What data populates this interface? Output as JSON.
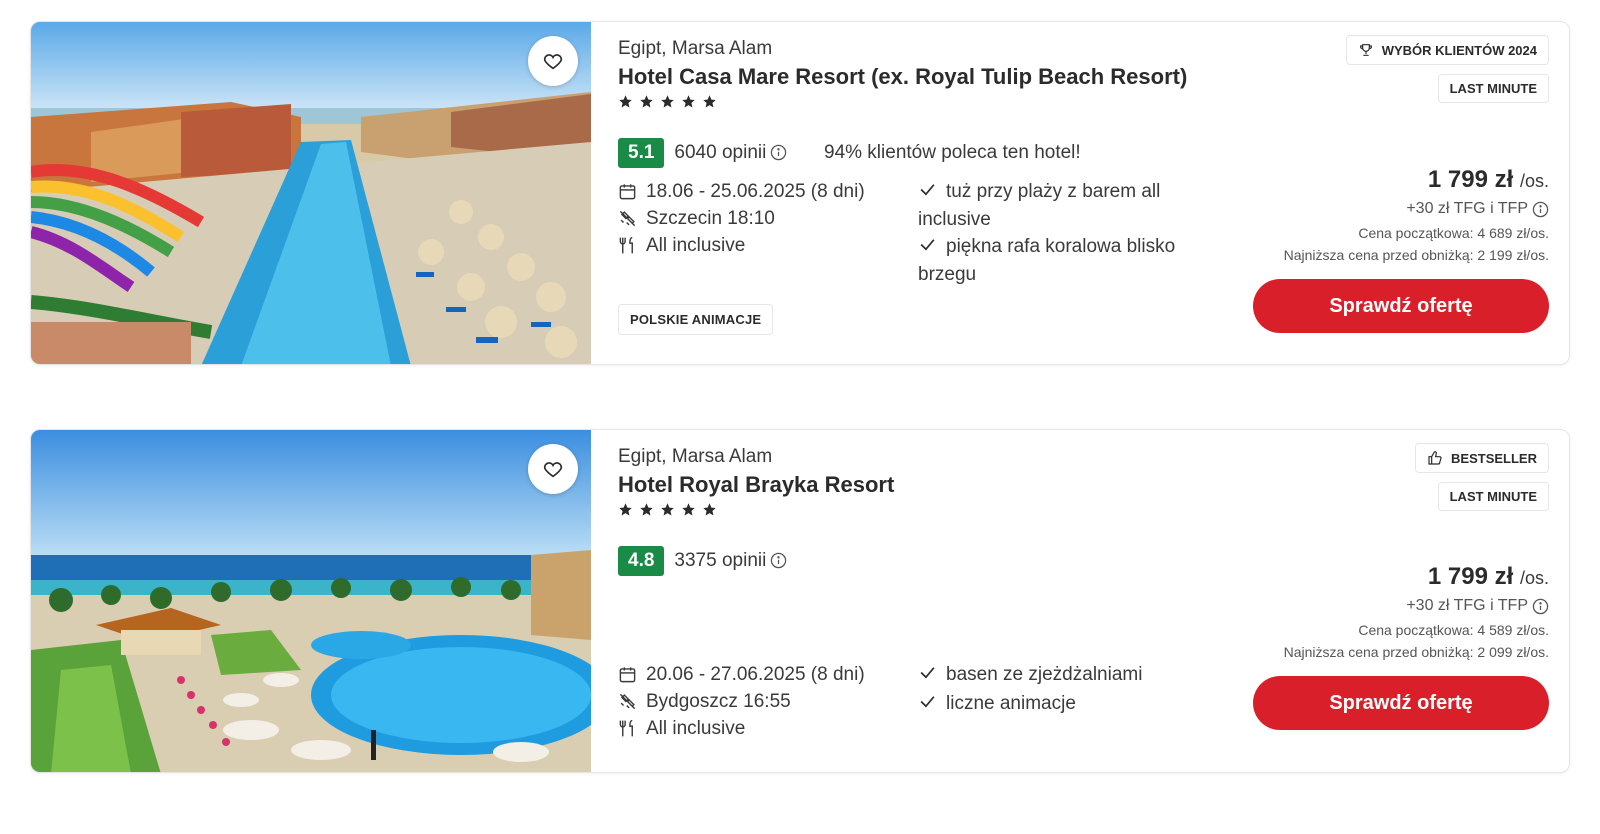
{
  "offers": [
    {
      "location": "Egipt, Marsa Alam",
      "name": "Hotel Casa Mare Resort (ex. Royal Tulip Beach Resort)",
      "stars": 5,
      "score": "5.1",
      "reviews": "6040 opinii",
      "recommend": "94% klientów poleca ten hotel!",
      "dates": "18.06 - 25.06.2025 (8 dni)",
      "departure": "Szczecin 18:10",
      "board": "All inclusive",
      "features": [
        "tuż przy plaży z barem all inclusive",
        "piękna rafa koralowa blisko brzegu"
      ],
      "tag": "POLSKIE ANIMACJE",
      "badge_primary": "WYBÓR KLIENTÓW 2024",
      "badge_primary_icon": "trophy-icon",
      "badge_secondary": "LAST MINUTE",
      "price": "1 799 zł",
      "price_unit": "/os.",
      "fees": "+30 zł TFG i TFP",
      "base_price": "Cena początkowa: 4 689 zł/os.",
      "lowest_price": "Najniższa cena przed obniżką: 2 199 zł/os.",
      "cta": "Sprawdź ofertę"
    },
    {
      "location": "Egipt, Marsa Alam",
      "name": "Hotel Royal Brayka Resort",
      "stars": 5,
      "score": "4.8",
      "reviews": "3375 opinii",
      "dates": "20.06 - 27.06.2025 (8 dni)",
      "departure": "Bydgoszcz 16:55",
      "board": "All inclusive",
      "features": [
        "basen ze zjeżdżalniami",
        "liczne animacje"
      ],
      "badge_primary": "BESTSELLER",
      "badge_primary_icon": "thumbs-up-icon",
      "badge_secondary": "LAST MINUTE",
      "price": "1 799 zł",
      "price_unit": "/os.",
      "fees": "+30 zł TFG i TFP",
      "base_price": "Cena początkowa: 4 589 zł/os.",
      "lowest_price": "Najniższa cena przed obniżką: 2 099 zł/os.",
      "cta": "Sprawdź ofertę"
    }
  ],
  "colors": {
    "accent": "#d9202a",
    "score_bg": "#1a8a47"
  }
}
